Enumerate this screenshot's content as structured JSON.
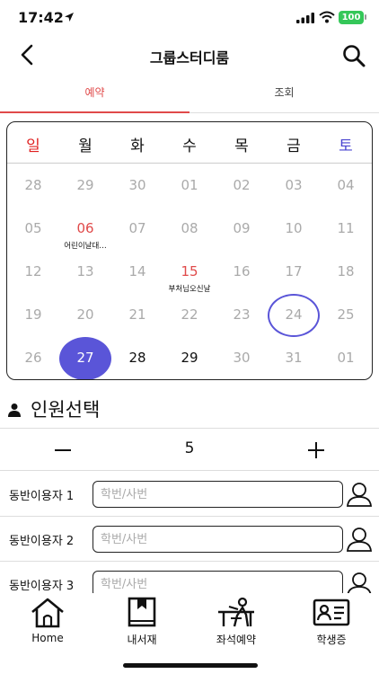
{
  "status_bar": {
    "time": "17:42",
    "battery": "100"
  },
  "nav": {
    "title": "그룹스터디룸"
  },
  "tabs": [
    {
      "label": "예약",
      "active": true
    },
    {
      "label": "조회",
      "active": false
    }
  ],
  "calendar": {
    "weekdays": [
      "일",
      "월",
      "화",
      "수",
      "목",
      "금",
      "토"
    ],
    "weekday_colors": {
      "sunday": "#e02020",
      "saturday": "#4a44d0"
    },
    "weeks": [
      [
        {
          "d": "28"
        },
        {
          "d": "29"
        },
        {
          "d": "30"
        },
        {
          "d": "01"
        },
        {
          "d": "02"
        },
        {
          "d": "03"
        },
        {
          "d": "04"
        }
      ],
      [
        {
          "d": "05"
        },
        {
          "d": "06",
          "red": true,
          "event": "어린이날대…"
        },
        {
          "d": "07"
        },
        {
          "d": "08"
        },
        {
          "d": "09"
        },
        {
          "d": "10"
        },
        {
          "d": "11"
        }
      ],
      [
        {
          "d": "12"
        },
        {
          "d": "13"
        },
        {
          "d": "14"
        },
        {
          "d": "15",
          "red": true,
          "event": "부처님오신날"
        },
        {
          "d": "16"
        },
        {
          "d": "17"
        },
        {
          "d": "18"
        }
      ],
      [
        {
          "d": "19"
        },
        {
          "d": "20"
        },
        {
          "d": "21"
        },
        {
          "d": "22"
        },
        {
          "d": "23"
        },
        {
          "d": "24",
          "today": true
        },
        {
          "d": "25"
        }
      ],
      [
        {
          "d": "26"
        },
        {
          "d": "27",
          "selected": true
        },
        {
          "d": "28",
          "current": true
        },
        {
          "d": "29",
          "current": true
        },
        {
          "d": "30"
        },
        {
          "d": "31"
        },
        {
          "d": "01"
        }
      ]
    ],
    "accent": "#5a55d8"
  },
  "people": {
    "title": "인원선택",
    "count": "5",
    "companions": [
      {
        "label": "동반이용자 1",
        "placeholder": "학번/사번"
      },
      {
        "label": "동반이용자 2",
        "placeholder": "학번/사번"
      },
      {
        "label": "동반이용자 3",
        "placeholder": "학번/사번"
      }
    ]
  },
  "bottom_nav": [
    {
      "label": "Home",
      "icon": "home-icon"
    },
    {
      "label": "내서재",
      "icon": "bookmark-book-icon"
    },
    {
      "label": "좌석예약",
      "icon": "seat-reservation-icon"
    },
    {
      "label": "학생증",
      "icon": "student-id-icon"
    }
  ]
}
